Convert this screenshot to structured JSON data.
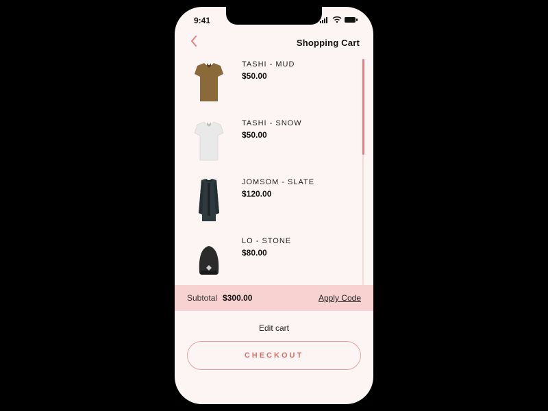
{
  "statusbar": {
    "time": "9:41"
  },
  "header": {
    "title": "Shopping Cart"
  },
  "cart": {
    "items": [
      {
        "name": "TASHI - MUD",
        "price": "$50.00"
      },
      {
        "name": "TASHI - SNOW",
        "price": "$50.00"
      },
      {
        "name": "JOMSOM - SLATE",
        "price": "$120.00"
      },
      {
        "name": "LO - STONE",
        "price": "$80.00"
      }
    ]
  },
  "subtotal": {
    "label": "Subtotal",
    "amount": "$300.00",
    "apply_code": "Apply Code"
  },
  "actions": {
    "edit_cart": "Edit cart",
    "checkout": "CHECKOUT"
  }
}
